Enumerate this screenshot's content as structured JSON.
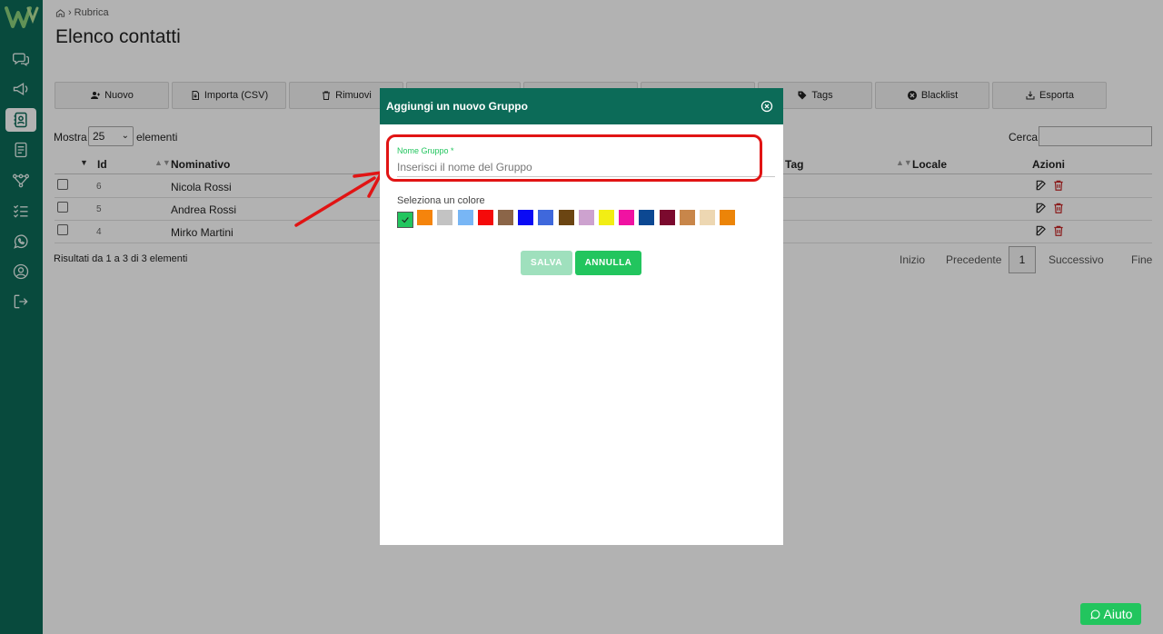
{
  "breadcrumb": {
    "label": "Rubrica"
  },
  "page": {
    "title": "Elenco contatti"
  },
  "toolbar": {
    "buttons": [
      {
        "label": "Nuovo"
      },
      {
        "label": "Importa (CSV)"
      },
      {
        "label": "Rimuovi"
      },
      {
        "label": ""
      },
      {
        "label": ""
      },
      {
        "label": ""
      },
      {
        "label": "Tags"
      },
      {
        "label": "Blacklist"
      },
      {
        "label": "Esporta"
      }
    ]
  },
  "length": {
    "prefix": "Mostra",
    "value": "25",
    "suffix": "elementi"
  },
  "search": {
    "label": "Cerca:"
  },
  "table": {
    "columns": {
      "id": "Id",
      "name": "Nominativo",
      "tag": "Tag",
      "locale": "Locale",
      "actions": "Azioni"
    },
    "rows": [
      {
        "id": "6",
        "name": "Nicola Rossi"
      },
      {
        "id": "5",
        "name": "Andrea Rossi"
      },
      {
        "id": "4",
        "name": "Mirko Martini"
      }
    ],
    "info": "Risultati da 1 a 3 di 3 elementi"
  },
  "pagination": {
    "first": "Inizio",
    "prev": "Precedente",
    "current": "1",
    "next": "Successivo",
    "last": "Fine"
  },
  "modal": {
    "title": "Aggiungi un nuovo Gruppo",
    "field_label": "Nome Gruppo *",
    "field_placeholder": "Inserisci il nome del Gruppo",
    "color_label": "Seleziona un colore",
    "colors": [
      "#22c55e",
      "#f5840c",
      "#c3c3c3",
      "#78b6f5",
      "#f50a0a",
      "#8b6548",
      "#0a0af5",
      "#3f68dc",
      "#6b4512",
      "#cda2cf",
      "#f2ee14",
      "#f012a2",
      "#0c4892",
      "#7b0a2e",
      "#c8864a",
      "#edd7b2",
      "#ec8408"
    ],
    "save_label": "SALVA",
    "cancel_label": "ANNULLA"
  },
  "help": {
    "label": "Aiuto"
  },
  "accent": {
    "primary": "#0c6b58",
    "green": "#22c55e",
    "highlight": "#e11414"
  }
}
